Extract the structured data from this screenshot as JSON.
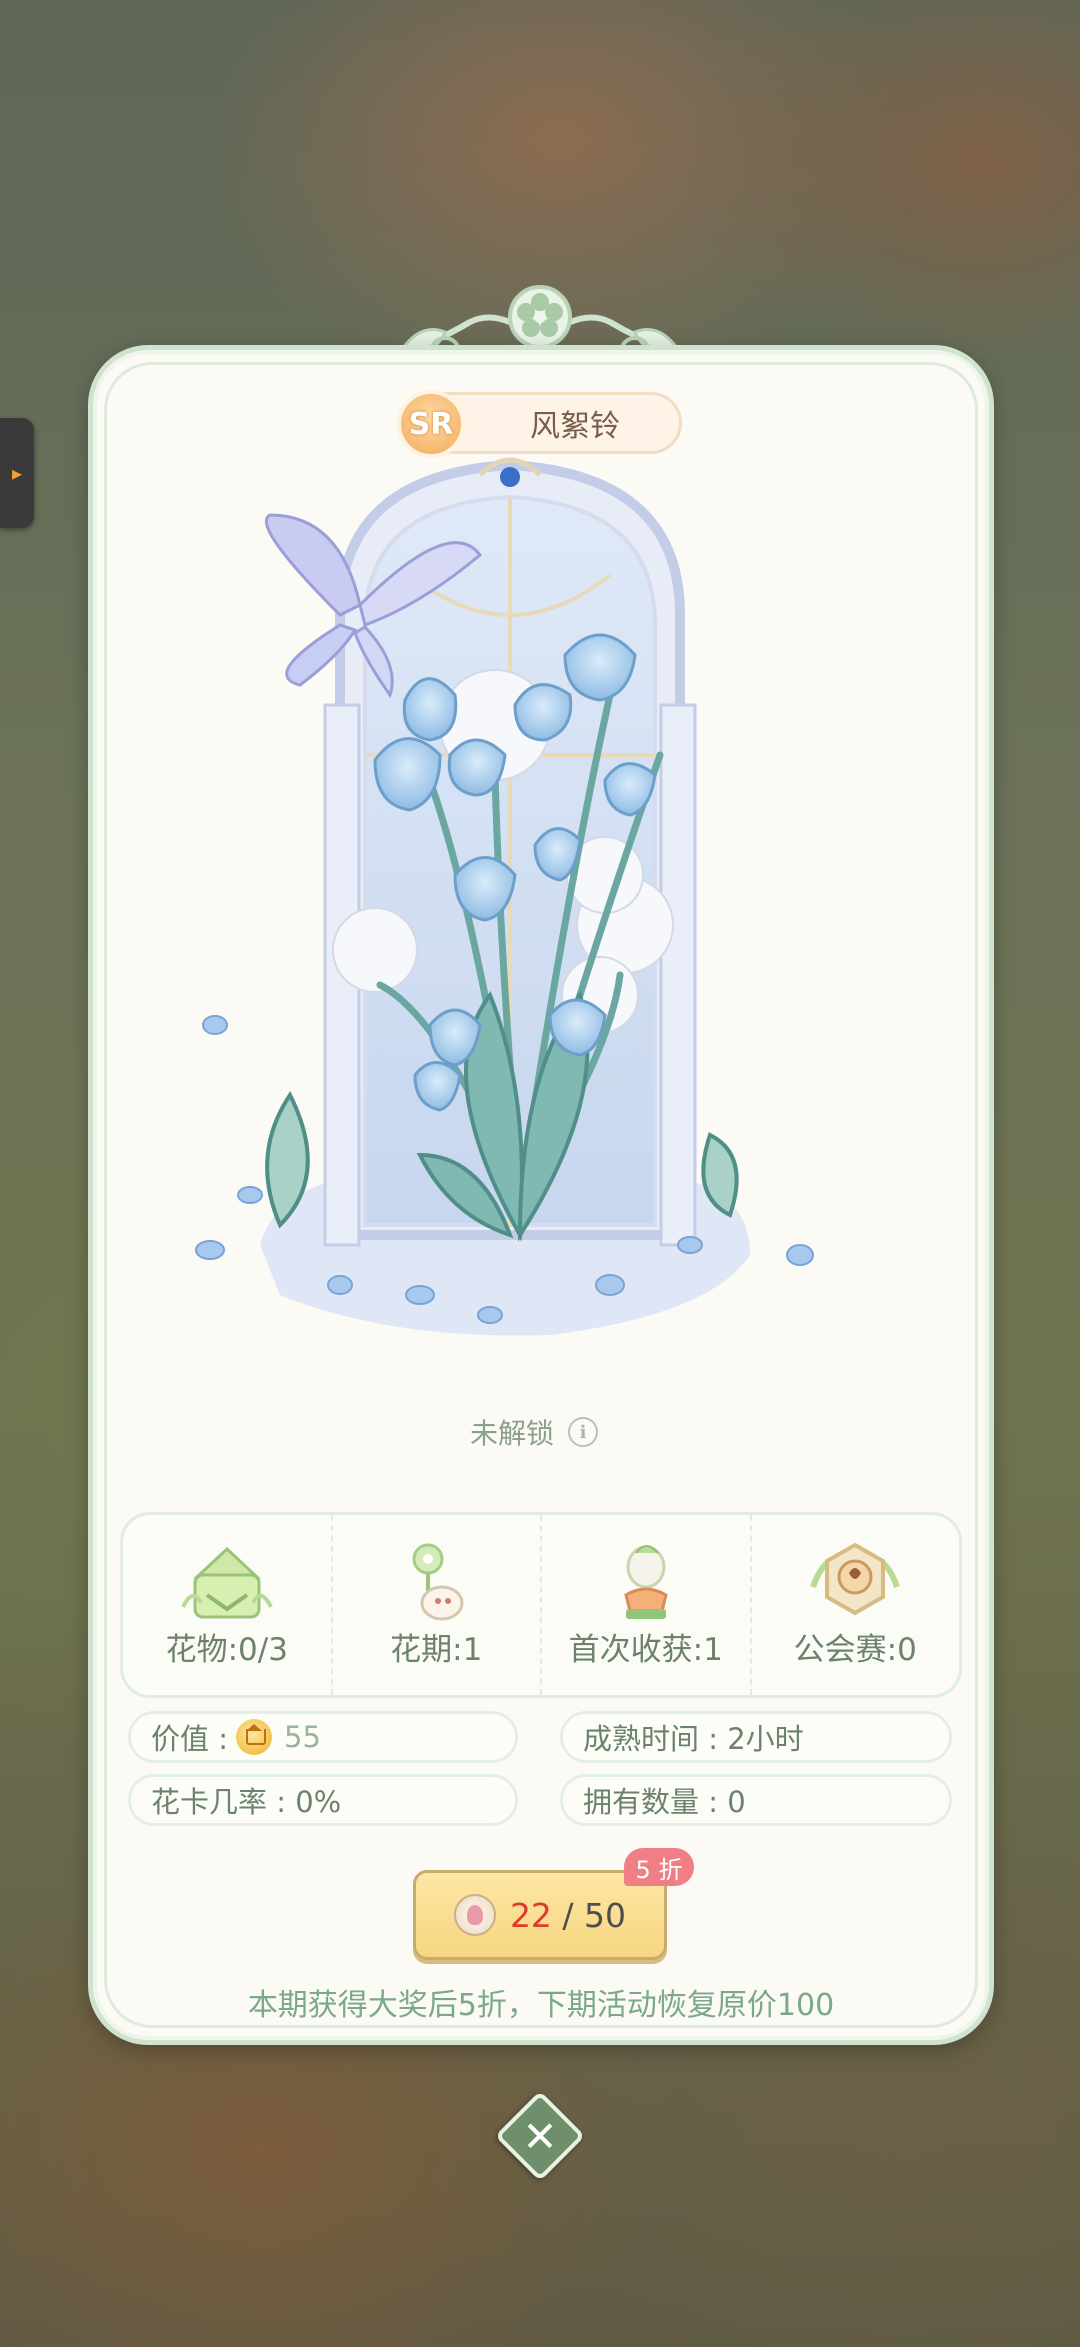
{
  "colors": {
    "card_bg": "#fbfaf5",
    "card_border": "#cfe3cf",
    "accent_green": "#6c826e",
    "price_current": "#e03a2e",
    "discount_badge": "#ef7f85",
    "button_yellow": "#f7d680"
  },
  "plant": {
    "rarity": "SR",
    "name": "风絮铃",
    "lock_status": "未解锁"
  },
  "stats": [
    {
      "icon": "flower-pot-icon",
      "label": "花物:0/3"
    },
    {
      "icon": "flower-period-icon",
      "label": "花期:1"
    },
    {
      "icon": "first-harvest-icon",
      "label": "首次收获:1"
    },
    {
      "icon": "guild-match-icon",
      "label": "公会赛:0"
    }
  ],
  "details": {
    "value_label": "价值 :",
    "value_amount": "55",
    "mature_time": "成熟时间 : 2小时",
    "card_rate": "花卡几率 : 0%",
    "owned_count": "拥有数量 : 0"
  },
  "purchase": {
    "discount_badge": "5 折",
    "current": "22",
    "separator": " / ",
    "total": "50",
    "notice": "本期获得大奖后5折，下期活动恢复原价100"
  },
  "icons": {
    "side_tab": "chevron-right-icon",
    "info": "info-icon",
    "coin": "coin-icon",
    "flower_token": "flower-token-icon",
    "close": "close-icon"
  }
}
